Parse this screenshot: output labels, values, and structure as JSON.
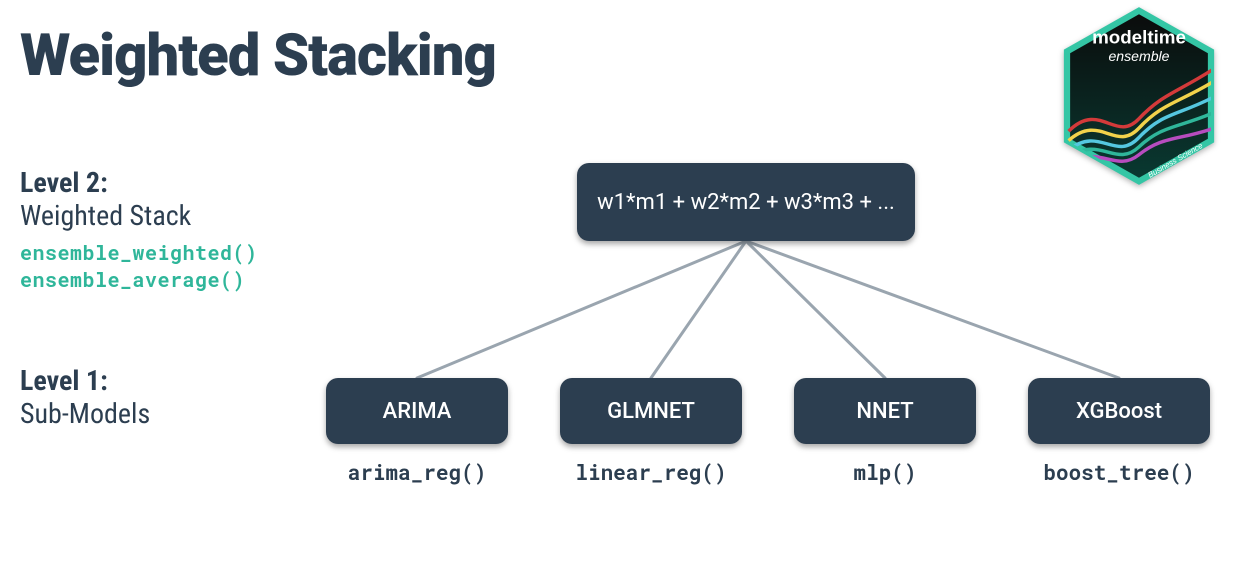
{
  "title": "Weighted Stacking",
  "logo": {
    "top_line": "modeltime",
    "sub_line": "ensemble",
    "footer": "Business Science",
    "border_color": "#34c6a5",
    "bg_top": "#0b0b0b",
    "bg_bottom": "#062a24",
    "wave_colors": [
      "#d33a3a",
      "#f2d24b",
      "#55c7e0",
      "#2fb69a",
      "#b74cbf"
    ]
  },
  "level2": {
    "heading": "Level 2:",
    "subheading": "Weighted Stack",
    "functions": [
      "ensemble_weighted()",
      "ensemble_average()"
    ],
    "formula": "w1*m1 + w2*m2 + w3*m3 + ..."
  },
  "level1": {
    "heading": "Level 1:",
    "subheading": "Sub-Models",
    "models": [
      {
        "name": "ARIMA",
        "fn": "arima_reg()"
      },
      {
        "name": "GLMNET",
        "fn": "linear_reg()"
      },
      {
        "name": "NNET",
        "fn": "mlp()"
      },
      {
        "name": "XGBoost",
        "fn": "boost_tree()"
      }
    ]
  },
  "colors": {
    "node_bg": "#2c3e50",
    "code_accent": "#2fb69a",
    "wire": "#9aa5af"
  }
}
